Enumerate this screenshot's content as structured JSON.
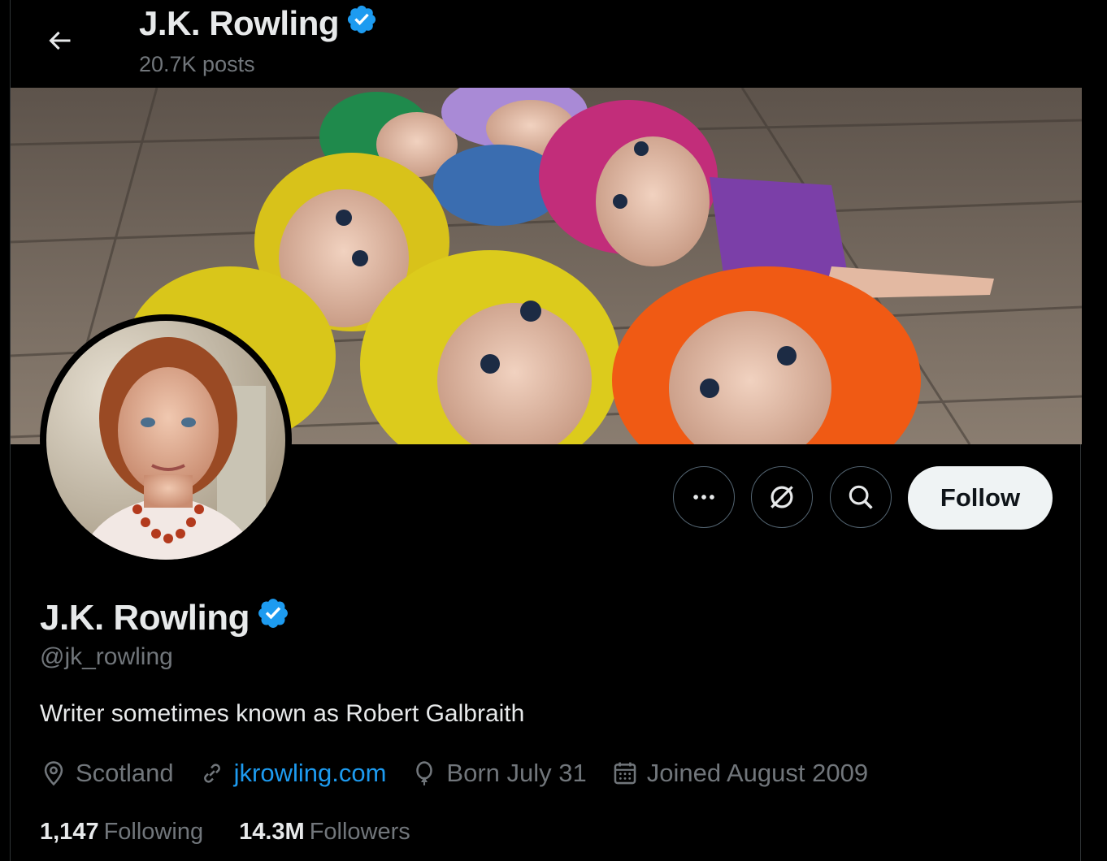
{
  "header": {
    "name": "J.K. Rowling",
    "posts_count": "20.7K posts"
  },
  "profile": {
    "name": "J.K. Rowling",
    "handle": "@jk_rowling",
    "bio": "Writer sometimes known as Robert Galbraith",
    "location": "Scotland",
    "website": "jkrowling.com",
    "birthday": "Born July 31",
    "joined": "Joined August 2009"
  },
  "actions": {
    "follow_label": "Follow",
    "more_icon": "more-icon",
    "grok_icon": "grok-icon",
    "search_icon": "search-icon"
  },
  "stats": {
    "following_count": "1,147",
    "following_label": "Following",
    "followers_count": "14.3M",
    "followers_label": "Followers"
  },
  "colors": {
    "background": "#000000",
    "text_primary": "#e7e9ea",
    "text_secondary": "#71767b",
    "link": "#1d9bf0",
    "verified": "#1d9bf0",
    "follow_bg": "#eff3f4"
  }
}
